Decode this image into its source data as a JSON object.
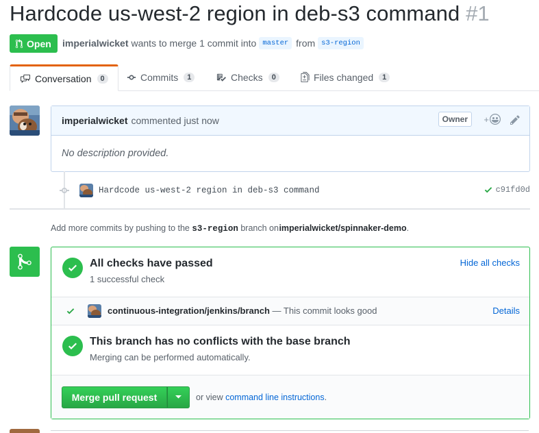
{
  "pr": {
    "title": "Hardcode us-west-2 region in deb-s3 command",
    "number": "#1",
    "state": "Open",
    "author": "imperialwicket",
    "merge_text": "wants to merge 1 commit into",
    "base_branch": "master",
    "from_text": "from",
    "head_branch": "s3-region"
  },
  "tabs": [
    {
      "label": "Conversation",
      "count": "0",
      "icon": "comment-discussion-icon"
    },
    {
      "label": "Commits",
      "count": "1",
      "icon": "git-commit-icon"
    },
    {
      "label": "Checks",
      "count": "0",
      "icon": "checklist-icon"
    },
    {
      "label": "Files changed",
      "count": "1",
      "icon": "file-diff-icon"
    }
  ],
  "comment": {
    "author": "imperialwicket",
    "action": "commented just now",
    "badge": "Owner",
    "reaction_plus": "+",
    "body": "No description provided."
  },
  "commit": {
    "message": "Hardcode us-west-2 region in deb-s3 command",
    "sha": "c91fd0d"
  },
  "hint": {
    "prefix": "Add more commits by pushing to the",
    "branch": "s3-region",
    "middle": "branch on",
    "repo": "imperialwicket/spinnaker-demo",
    "suffix": "."
  },
  "checks": {
    "title": "All checks have passed",
    "subtitle": "1 successful check",
    "hide_label": "Hide all checks",
    "item_context": "continuous-integration/jenkins/branch",
    "item_desc": "— This commit looks good",
    "details_label": "Details"
  },
  "conflicts": {
    "title": "This branch has no conflicts with the base branch",
    "subtitle": "Merging can be performed automatically."
  },
  "merge": {
    "button_label": "Merge pull request",
    "or_view": "or view",
    "cli_link": "command line instructions",
    "period": "."
  },
  "colors": {
    "green": "#2cbe4e",
    "link": "#0366d6",
    "tab_accent": "#e36209"
  }
}
